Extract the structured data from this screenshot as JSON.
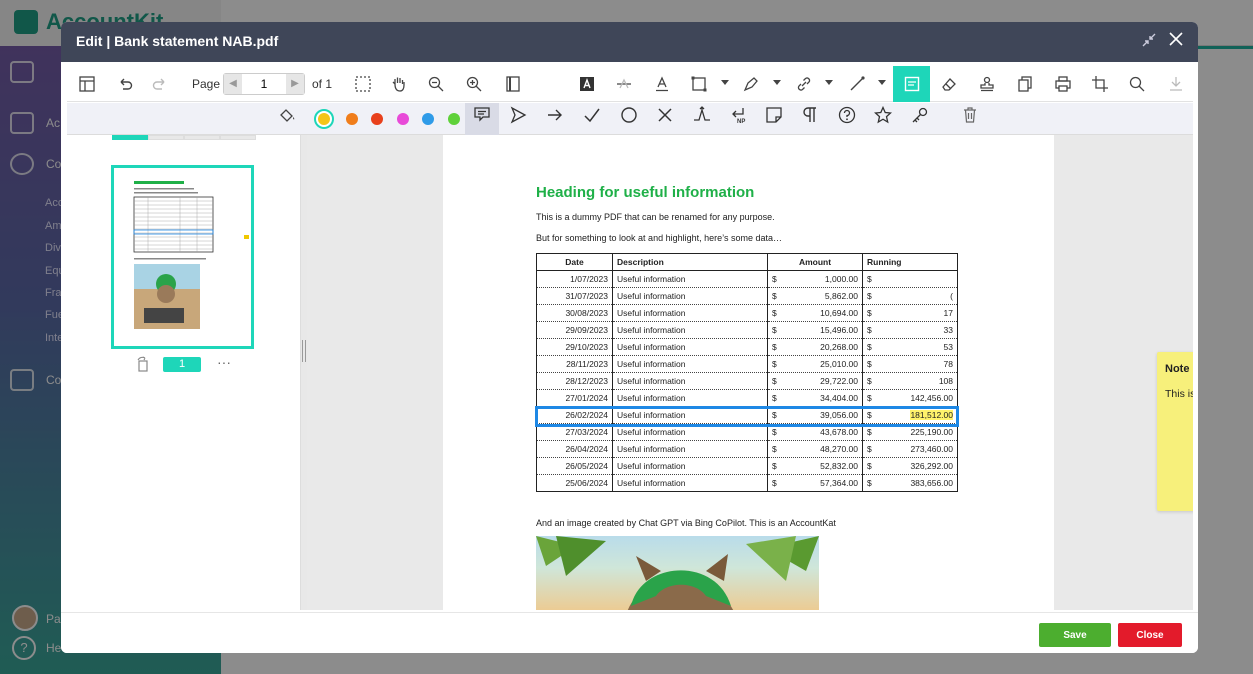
{
  "app": {
    "name": "AccountKit",
    "sidebar_items": [
      "Ac",
      "Co",
      "Co"
    ],
    "sub_items": [
      "Acc",
      "Am",
      "Div",
      "Equ",
      "Fra",
      "Fue",
      "Inte"
    ],
    "user": "Pa",
    "help": "He"
  },
  "modal": {
    "title": "Edit | Bank statement NAB.pdf",
    "toolbar": {
      "page_label": "Page",
      "page_value": "1",
      "page_of": "of 1"
    },
    "colors": [
      "#f5c518",
      "#f07d1a",
      "#e8401c",
      "#e84ad8",
      "#2f9be8",
      "#5fd13a"
    ],
    "thumbnail": {
      "page_number": "1",
      "more": "···"
    },
    "document": {
      "heading": "Heading for useful information",
      "intro1": "This is a dummy PDF that can be renamed for any purpose.",
      "intro2": "But for something to look at and highlight, here’s some data…",
      "columns": [
        "Date",
        "Description",
        "Amount",
        "Running"
      ],
      "rows": [
        {
          "date": "1/07/2023",
          "desc": "Useful information",
          "cur": "$",
          "amount": "1,000.00",
          "run_cur": "$",
          "running": ""
        },
        {
          "date": "31/07/2023",
          "desc": "Useful information",
          "cur": "$",
          "amount": "5,862.00",
          "run_cur": "$",
          "running": "("
        },
        {
          "date": "30/08/2023",
          "desc": "Useful information",
          "cur": "$",
          "amount": "10,694.00",
          "run_cur": "$",
          "running": "17"
        },
        {
          "date": "29/09/2023",
          "desc": "Useful information",
          "cur": "$",
          "amount": "15,496.00",
          "run_cur": "$",
          "running": "33"
        },
        {
          "date": "29/10/2023",
          "desc": "Useful information",
          "cur": "$",
          "amount": "20,268.00",
          "run_cur": "$",
          "running": "53"
        },
        {
          "date": "28/11/2023",
          "desc": "Useful information",
          "cur": "$",
          "amount": "25,010.00",
          "run_cur": "$",
          "running": "78"
        },
        {
          "date": "28/12/2023",
          "desc": "Useful information",
          "cur": "$",
          "amount": "29,722.00",
          "run_cur": "$",
          "running": "108"
        },
        {
          "date": "27/01/2024",
          "desc": "Useful information",
          "cur": "$",
          "amount": "34,404.00",
          "run_cur": "$",
          "running": "142,456.00"
        },
        {
          "date": "26/02/2024",
          "desc": "Useful information",
          "cur": "$",
          "amount": "39,056.00",
          "run_cur": "$",
          "running": "181,512.00"
        },
        {
          "date": "27/03/2024",
          "desc": "Useful information",
          "cur": "$",
          "amount": "43,678.00",
          "run_cur": "$",
          "running": "225,190.00"
        },
        {
          "date": "26/04/2024",
          "desc": "Useful information",
          "cur": "$",
          "amount": "48,270.00",
          "run_cur": "$",
          "running": "273,460.00"
        },
        {
          "date": "26/05/2024",
          "desc": "Useful information",
          "cur": "$",
          "amount": "52,832.00",
          "run_cur": "$",
          "running": "326,292.00"
        },
        {
          "date": "25/06/2024",
          "desc": "Useful information",
          "cur": "$",
          "amount": "57,364.00",
          "run_cur": "$",
          "running": "383,656.00"
        }
      ],
      "highlighted_row_index": 8,
      "image_caption": "And an image created by Chat GPT via Bing CoPilot. This is an AccountKat"
    },
    "note": {
      "title": "Note",
      "body": "This is a really important number!!"
    },
    "footer": {
      "save_label": "Save",
      "close_label": "Close"
    }
  }
}
